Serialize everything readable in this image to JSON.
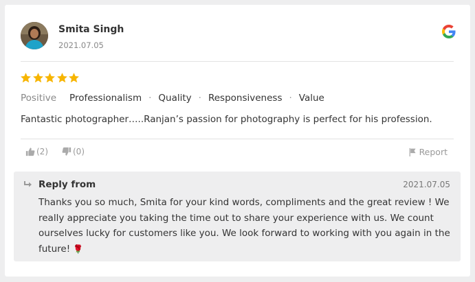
{
  "review": {
    "author": "Smita Singh",
    "date": "2021.07.05",
    "source_icon": "google-g-icon",
    "rating": 5,
    "max_rating": 5,
    "sentiment": "Positive",
    "tags": [
      "Professionalism",
      "Quality",
      "Responsiveness",
      "Value"
    ],
    "text": "Fantastic photographer…..Ranjan’s passion for photography is perfect for his profession.",
    "likes": "(2)",
    "dislikes": "(0)",
    "report_label": "Report"
  },
  "reply": {
    "title": "Reply from",
    "date": "2021.07.05",
    "body": "Thanks you so much, Smita for your kind words, compliments and the great review ! We really appreciate you taking the time out to share your experience with us. We count ourselves lucky for customers like you. We look forward to working with you again in the future! ",
    "emoji": "🌹"
  },
  "colors": {
    "star": "#f7b500",
    "background": "#eeeeef",
    "card": "#ffffff",
    "muted_text": "#999999"
  }
}
